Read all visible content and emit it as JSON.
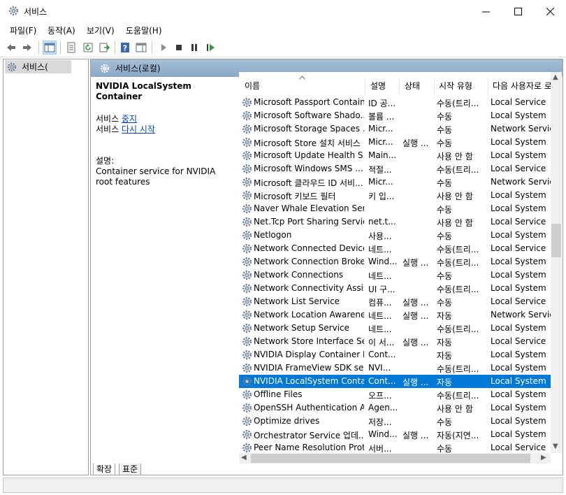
{
  "window": {
    "title": "서비스"
  },
  "menu": [
    "파일(F)",
    "동작(A)",
    "보기(V)",
    "도움말(H)"
  ],
  "tree": {
    "selected_label": "서비스("
  },
  "main": {
    "header_title": "서비스(로컬)",
    "detail": {
      "service_name": "NVIDIA LocalSystem Container",
      "action_prefix": "서비스",
      "stop_link": "중지",
      "restart_link": "다시 시작",
      "desc_label": "설명:",
      "desc_text": "Container service for NVIDIA root features"
    },
    "columns": [
      "이름",
      "설명",
      "상태",
      "시작 유형",
      "다음 사용자로 로"
    ],
    "rows": [
      {
        "name": "Microsoft Passport Container",
        "desc": "ID 공...",
        "status": "",
        "startup": "수동(트리...",
        "logon": "Local Service"
      },
      {
        "name": "Microsoft Software Shado...",
        "desc": "볼륨 ...",
        "status": "",
        "startup": "수동",
        "logon": "Local System"
      },
      {
        "name": "Microsoft Storage Spaces ...",
        "desc": "Micr...",
        "status": "",
        "startup": "수동",
        "logon": "Network Service"
      },
      {
        "name": "Microsoft Store 설치 서비스",
        "desc": "Micr...",
        "status": "실행 ...",
        "startup": "수동",
        "logon": "Local System"
      },
      {
        "name": "Microsoft Update Health S...",
        "desc": "Main...",
        "status": "",
        "startup": "사용 안 함",
        "logon": "Local System"
      },
      {
        "name": "Microsoft Windows SMS ...",
        "desc": "적절...",
        "status": "",
        "startup": "수동(트리...",
        "logon": "Local Service"
      },
      {
        "name": "Microsoft 클라우드 ID 서비...",
        "desc": "Micr...",
        "status": "",
        "startup": "수동",
        "logon": "Network Service"
      },
      {
        "name": "Microsoft 키보드 필터",
        "desc": "키 입...",
        "status": "",
        "startup": "사용 안 함",
        "logon": "Local System"
      },
      {
        "name": "Naver Whale Elevation Serv...",
        "desc": "",
        "status": "",
        "startup": "수동",
        "logon": "Local System"
      },
      {
        "name": "Net.Tcp Port Sharing Service",
        "desc": "net.t...",
        "status": "",
        "startup": "사용 안 함",
        "logon": "Local Service"
      },
      {
        "name": "Netlogon",
        "desc": "사용...",
        "status": "",
        "startup": "수동",
        "logon": "Local System"
      },
      {
        "name": "Network Connected Device...",
        "desc": "네트...",
        "status": "",
        "startup": "수동(트리...",
        "logon": "Local Service"
      },
      {
        "name": "Network Connection Broker",
        "desc": "Wind...",
        "status": "실행 ...",
        "startup": "수동(트리...",
        "logon": "Local System"
      },
      {
        "name": "Network Connections",
        "desc": "네트...",
        "status": "",
        "startup": "수동",
        "logon": "Local System"
      },
      {
        "name": "Network Connectivity Assis...",
        "desc": "UI 구...",
        "status": "",
        "startup": "수동(트리...",
        "logon": "Local System"
      },
      {
        "name": "Network List Service",
        "desc": "컴퓨...",
        "status": "실행 ...",
        "startup": "수동",
        "logon": "Local Service"
      },
      {
        "name": "Network Location Awareness",
        "desc": "네트...",
        "status": "실행 ...",
        "startup": "자동",
        "logon": "Network Service"
      },
      {
        "name": "Network Setup Service",
        "desc": "네트...",
        "status": "",
        "startup": "수동(트리...",
        "logon": "Local System"
      },
      {
        "name": "Network Store Interface Se...",
        "desc": "이 서...",
        "status": "실행 ...",
        "startup": "자동",
        "logon": "Local Service"
      },
      {
        "name": "NVIDIA Display Container LS",
        "desc": "Cont...",
        "status": "",
        "startup": "자동",
        "logon": "Local System"
      },
      {
        "name": "NVIDIA FrameView SDK se...",
        "desc": "NVI...",
        "status": "",
        "startup": "수동(트리...",
        "logon": "Local System"
      },
      {
        "name": "NVIDIA LocalSystem Conta...",
        "desc": "Cont...",
        "status": "실행 ...",
        "startup": "자동",
        "logon": "Local System",
        "selected": true
      },
      {
        "name": "Offline Files",
        "desc": "오프...",
        "status": "",
        "startup": "수동(트리...",
        "logon": "Local System"
      },
      {
        "name": "OpenSSH Authentication A...",
        "desc": "Agen...",
        "status": "",
        "startup": "사용 안 함",
        "logon": "Local System"
      },
      {
        "name": "Optimize drives",
        "desc": "저장...",
        "status": "",
        "startup": "수동",
        "logon": "Local System"
      },
      {
        "name": "Orchestrator Service 업데...",
        "desc": "Wind...",
        "status": "실행 ...",
        "startup": "자동(지연...",
        "logon": "Local System"
      },
      {
        "name": "Peer Name Resolution Prot...",
        "desc": "서버...",
        "status": "",
        "startup": "수동",
        "logon": "Local Service"
      }
    ]
  },
  "tabs": [
    "확장",
    "표준"
  ],
  "colors": {
    "selection": "#0078d7",
    "header_band": "#9bb5d0",
    "link": "#0645ad"
  }
}
